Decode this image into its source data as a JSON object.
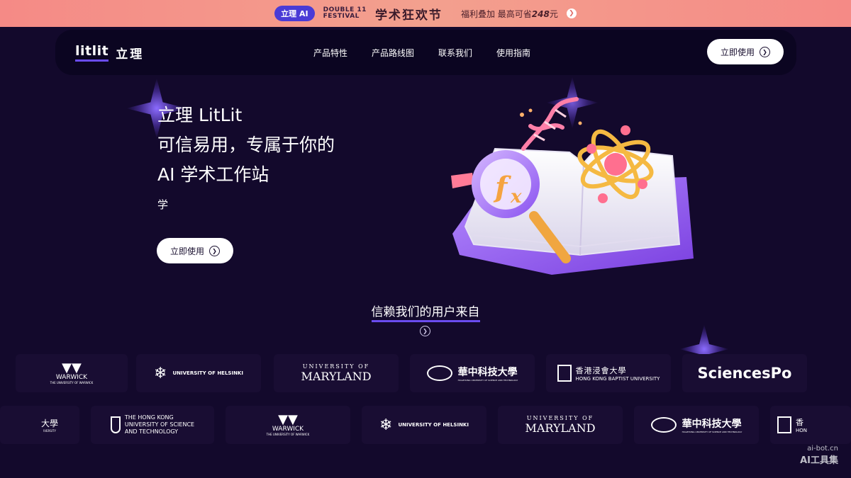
{
  "promo": {
    "badge": "立理 AI",
    "festival_line1": "DOUBLE 11",
    "festival_line2": "FESTIVAL",
    "title": "学术狂欢节",
    "text_prefix": "福利叠加 最高可省",
    "text_amount": "248",
    "text_suffix": "元"
  },
  "nav": {
    "logo_latin": "litlit",
    "logo_cn": "立理",
    "links": [
      "产品特性",
      "产品路线图",
      "联系我们",
      "使用指南"
    ],
    "cta": "立即使用"
  },
  "hero": {
    "title_line1": "立理 LitLit",
    "title_line2": "可信易用，专属于你的",
    "title_line3": "AI 学术工作站",
    "subtitle": "学",
    "cta": "立即使用"
  },
  "trust": {
    "title": "信赖我们的用户来自"
  },
  "logos_row1": {
    "warwick": "WARWICK",
    "warwick_sub": "THE UNIVERSITY OF WARWICK",
    "helsinki": "UNIVERSITY OF HELSINKI",
    "maryland_top": "UNIVERSITY OF",
    "maryland": "MARYLAND",
    "hust_cn": "華中科技大學",
    "hust_en": "HUAZHONG UNIVERSITY OF SCIENCE AND TECHNOLOGY",
    "hkbu_cn": "香港浸會大學",
    "hkbu_en": "HONG KONG BAPTIST UNIVERSITY",
    "sciencespo": "SciencesPo"
  },
  "logos_row2": {
    "partial_left": "大學",
    "partial_left_sub": "IVERSITY",
    "hkust_line1": "THE HONG KONG",
    "hkust_line2": "UNIVERSITY OF SCIENCE",
    "hkust_line3": "AND TECHNOLOGY",
    "warwick": "WARWICK",
    "warwick_sub": "THE UNIVERSITY OF WARWICK",
    "helsinki": "UNIVERSITY OF HELSINKI",
    "maryland_top": "UNIVERSITY OF",
    "maryland": "MARYLAND",
    "hust_cn": "華中科技大學",
    "hust_en": "HUAZHONG UNIVERSITY OF SCIENCE AND TECHNOLOGY",
    "partial_right_cn": "香",
    "partial_right_en": "HON"
  },
  "watermark": {
    "line1": "ai-bot.cn",
    "line2": "AI工具集"
  },
  "colors": {
    "background": "#13092c",
    "accent": "#6a4cf0",
    "promo": "#f58a86"
  }
}
